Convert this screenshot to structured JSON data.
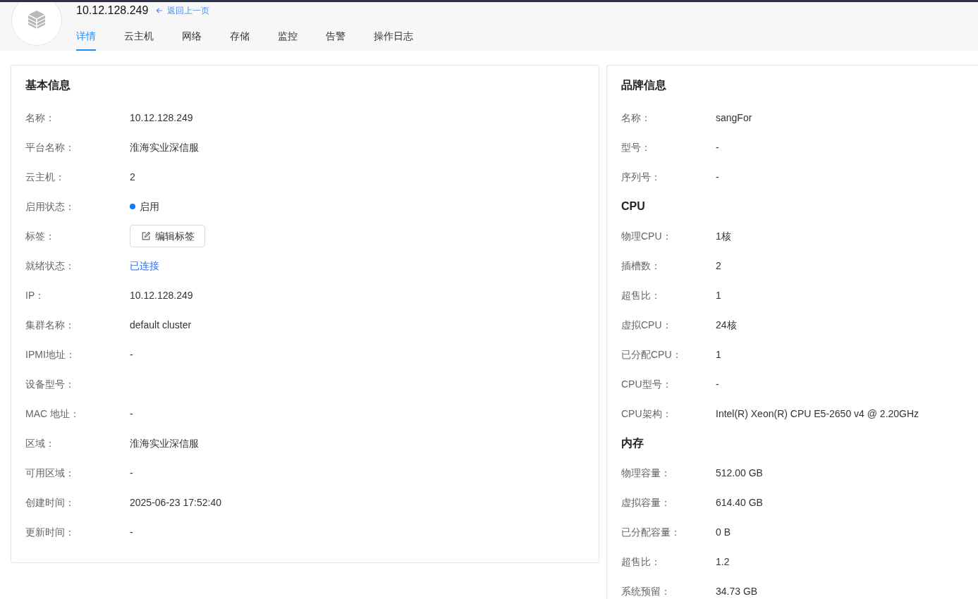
{
  "header": {
    "title": "10.12.128.249",
    "back_link": "返回上一页"
  },
  "tabs": [
    {
      "label": "详情",
      "selected": true
    },
    {
      "label": "云主机",
      "selected": false
    },
    {
      "label": "网络",
      "selected": false
    },
    {
      "label": "存储",
      "selected": false
    },
    {
      "label": "监控",
      "selected": false
    },
    {
      "label": "告警",
      "selected": false
    },
    {
      "label": "操作日志",
      "selected": false
    }
  ],
  "basic_info": {
    "title": "基本信息",
    "rows": [
      {
        "kind": "text",
        "label": "名称：",
        "value": "10.12.128.249"
      },
      {
        "kind": "text",
        "label": "平台名称：",
        "value": "淮海实业深信服"
      },
      {
        "kind": "text",
        "label": "云主机：",
        "value": "2"
      },
      {
        "kind": "status",
        "label": "启用状态：",
        "value": "启用",
        "color": "#1677ff"
      },
      {
        "kind": "button",
        "label": "标签：",
        "value": "编辑标签"
      },
      {
        "kind": "accent",
        "label": "就绪状态：",
        "value": "已连接"
      },
      {
        "kind": "text",
        "label": "IP：",
        "value": "10.12.128.249"
      },
      {
        "kind": "text",
        "label": "集群名称：",
        "value": "default cluster"
      },
      {
        "kind": "text",
        "label": "IPMI地址：",
        "value": "-"
      },
      {
        "kind": "text",
        "label": "设备型号："
      },
      {
        "kind": "text",
        "label": "MAC 地址：",
        "value": "-"
      },
      {
        "kind": "text",
        "label": "区域：",
        "value": "淮海实业深信服"
      },
      {
        "kind": "text",
        "label": "可用区域：",
        "value": "-"
      },
      {
        "kind": "text",
        "label": "创建时间：",
        "value": "2025-06-23 17:52:40"
      },
      {
        "kind": "text",
        "label": "更新时间：",
        "value": "-"
      }
    ]
  },
  "brand_info": {
    "title": "品牌信息",
    "sections": [
      {
        "rows": [
          {
            "label": "名称：",
            "value": "sangFor"
          },
          {
            "label": "型号：",
            "value": "-"
          },
          {
            "label": "序列号：",
            "value": "-"
          }
        ]
      },
      {
        "heading": "CPU",
        "rows": [
          {
            "label": "物理CPU：",
            "value": "1核"
          },
          {
            "label": "插槽数：",
            "value": "2"
          },
          {
            "label": "超售比：",
            "value": "1"
          },
          {
            "label": "虚拟CPU：",
            "value": "24核"
          },
          {
            "label": "已分配CPU：",
            "value": "1"
          },
          {
            "label": "CPU型号：",
            "value": "-"
          },
          {
            "label": "CPU架构：",
            "value": "Intel(R) Xeon(R) CPU E5-2650 v4 @ 2.20GHz"
          }
        ]
      },
      {
        "heading": "内存",
        "rows": [
          {
            "label": "物理容量：",
            "value": "512.00 GB"
          },
          {
            "label": "虚拟容量：",
            "value": "614.40 GB"
          },
          {
            "label": "已分配容量：",
            "value": "0 B"
          },
          {
            "label": "超售比：",
            "value": "1.2"
          },
          {
            "label": "系统预留：",
            "value": "34.73 GB"
          }
        ]
      }
    ]
  }
}
